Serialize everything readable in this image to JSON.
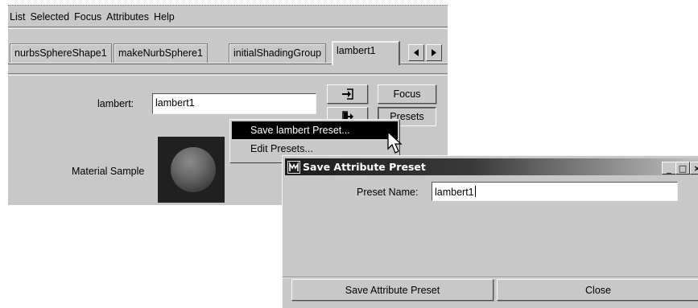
{
  "editor": {
    "menu": [
      "List",
      "Selected",
      "Focus",
      "Attributes",
      "Help"
    ],
    "tabs": [
      "nurbsSphereShape1",
      "makeNurbSphere1",
      "initialShadingGroup",
      "lambert1"
    ],
    "active_tab": "lambert1",
    "name_label": "lambert:",
    "name_value": "lambert1",
    "focus_label": "Focus",
    "presets_label": "Presets",
    "sample_label": "Material Sample"
  },
  "popup_menu": {
    "items": [
      "Save lambert Preset...",
      "Edit Presets..."
    ],
    "highlighted_index": 0
  },
  "dialog": {
    "title": "Save Attribute Preset",
    "window_controls": [
      "_",
      "□",
      "×"
    ],
    "preset_name_label": "Preset Name:",
    "preset_name_value": "lambert1",
    "save_button": "Save Attribute Preset",
    "close_button": "Close"
  },
  "colors": {
    "panel_bg": "#c8c8c8",
    "highlight_bg": "#000000",
    "highlight_fg": "#ffffff"
  },
  "icons": {
    "load_icon": "arrow-into-box-icon",
    "save_icon": "arrow-out-of-box-icon",
    "scroll_left": "triangle-left-icon",
    "scroll_right": "triangle-right-icon",
    "dialog_icon": "maya-logo-icon",
    "cursor": "mouse-pointer-icon"
  }
}
